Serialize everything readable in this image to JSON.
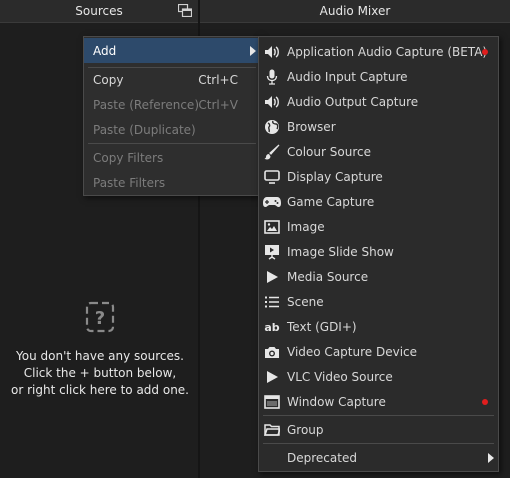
{
  "sources_header": {
    "title": "Sources"
  },
  "mixer_header": {
    "title": "Audio Mixer"
  },
  "empty_state": {
    "line1": "You don't have any sources.",
    "line2": "Click the + button below,",
    "line3": "or right click here to add one."
  },
  "context_menu": {
    "add": "Add",
    "copy": "Copy",
    "copy_shortcut": "Ctrl+C",
    "paste_reference": "Paste (Reference)",
    "paste_reference_shortcut": "Ctrl+V",
    "paste_duplicate": "Paste (Duplicate)",
    "copy_filters": "Copy Filters",
    "paste_filters": "Paste Filters"
  },
  "add_menu": {
    "items": [
      {
        "label": "Application Audio Capture (BETA)",
        "icon": "speaker-icon",
        "badge": true
      },
      {
        "label": "Audio Input Capture",
        "icon": "microphone-icon",
        "badge": false
      },
      {
        "label": "Audio Output Capture",
        "icon": "speaker-icon",
        "badge": false
      },
      {
        "label": "Browser",
        "icon": "globe-icon",
        "badge": false
      },
      {
        "label": "Colour Source",
        "icon": "brush-icon",
        "badge": false
      },
      {
        "label": "Display Capture",
        "icon": "monitor-icon",
        "badge": false
      },
      {
        "label": "Game Capture",
        "icon": "gamepad-icon",
        "badge": false
      },
      {
        "label": "Image",
        "icon": "image-icon",
        "badge": false
      },
      {
        "label": "Image Slide Show",
        "icon": "slideshow-icon",
        "badge": false
      },
      {
        "label": "Media Source",
        "icon": "play-icon",
        "badge": false
      },
      {
        "label": "Scene",
        "icon": "list-icon",
        "badge": false
      },
      {
        "label": "Text (GDI+)",
        "icon": "text-icon",
        "badge": false
      },
      {
        "label": "Video Capture Device",
        "icon": "camera-icon",
        "badge": false
      },
      {
        "label": "VLC Video Source",
        "icon": "play-icon",
        "badge": false
      },
      {
        "label": "Window Capture",
        "icon": "window-icon",
        "badge": true
      }
    ],
    "group": "Group",
    "deprecated": "Deprecated"
  },
  "colors": {
    "badge": "#e01e1e",
    "selected": "#2d4a6b"
  }
}
